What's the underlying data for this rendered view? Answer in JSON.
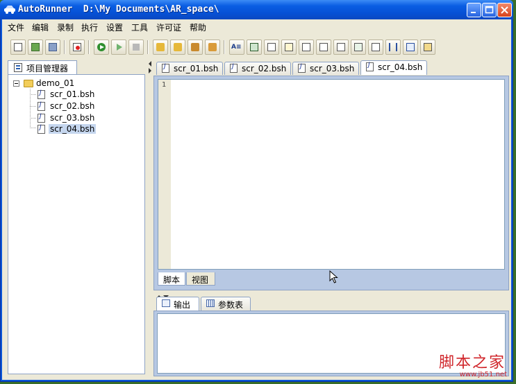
{
  "window": {
    "title": "AutoRunner  D:\\My Documents\\AR_space\\",
    "controls": [
      "minimize",
      "maximize",
      "close"
    ]
  },
  "menu": {
    "items": [
      "文件",
      "编辑",
      "录制",
      "执行",
      "设置",
      "工具",
      "许可证",
      "帮助"
    ]
  },
  "toolbar": {
    "buttons": [
      {
        "icon": "new-script-icon"
      },
      {
        "icon": "open-icon"
      },
      {
        "icon": "save-icon"
      },
      {
        "icon": "record-icon"
      },
      {
        "icon": "run-icon"
      },
      {
        "icon": "step-run-icon"
      },
      {
        "icon": "stop-icon"
      },
      {
        "icon": "undo-icon"
      },
      {
        "icon": "redo-icon"
      },
      {
        "icon": "tool-1-icon"
      },
      {
        "icon": "tool-2-icon"
      },
      {
        "icon": "text-check-icon"
      },
      {
        "icon": "insert-icon"
      },
      {
        "icon": "check-1-icon"
      },
      {
        "icon": "check-2-icon"
      },
      {
        "icon": "check-3-icon"
      },
      {
        "icon": "check-4-icon"
      },
      {
        "icon": "check-5-icon"
      },
      {
        "icon": "check-6-icon"
      },
      {
        "icon": "check-7-icon"
      },
      {
        "icon": "parameter-icon"
      },
      {
        "icon": "output-icon"
      },
      {
        "icon": "settings-icon"
      }
    ]
  },
  "project_panel": {
    "tab_label": "项目管理器",
    "project": "demo_01",
    "files": [
      "scr_01.bsh",
      "scr_02.bsh",
      "scr_03.bsh",
      "scr_04.bsh"
    ],
    "selected_file": "scr_04.bsh"
  },
  "editor": {
    "tabs": [
      "scr_01.bsh",
      "scr_02.bsh",
      "scr_03.bsh",
      "scr_04.bsh"
    ],
    "active_tab": "scr_04.bsh",
    "line_number": "1",
    "view_tabs": [
      "脚本",
      "视图"
    ],
    "active_view": "脚本"
  },
  "output_panel": {
    "tabs": [
      "输出",
      "参数表"
    ],
    "active_tab": "输出"
  },
  "watermark": {
    "text": "脚本之家",
    "url": "www.jb51.net"
  },
  "colors": {
    "titlebar": "#0a5ee3",
    "client_bg": "#ece9d8",
    "selection": "#c5d6ee",
    "panel_border": "#8da2c4",
    "watermark": "#d0262b"
  }
}
